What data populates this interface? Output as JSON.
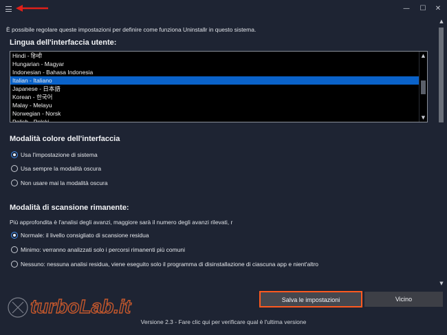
{
  "titlebar": {
    "minimize": "—",
    "maximize": "☐",
    "close": "✕"
  },
  "intro_text": "È possibile regolare queste impostazioni per definire come funziona Uninstallr in questo sistema.",
  "language": {
    "title": "Lingua dell'interfaccia utente:",
    "items": [
      "Hindi - हिन्दी",
      "Hungarian - Magyar",
      "Indonesian - Bahasa Indonesia",
      "Italian - Italiano",
      "Japanese - 日本語",
      "Korean - 한국어",
      "Malay - Melayu",
      "Norwegian - Norsk",
      "Polish - Polski"
    ],
    "selected_index": 3
  },
  "color_mode": {
    "title": "Modalità colore dell'interfaccia",
    "options": [
      "Usa l'impostazione di sistema",
      "Usa sempre la modalità oscura",
      "Non usare mai la modalità oscura"
    ],
    "selected_index": 0
  },
  "scan_mode": {
    "title": "Modalità di scansione rimanente:",
    "description": "Più approfondita è l'analisi degli avanzi, maggiore sarà il numero degli avanzi rilevati, r",
    "options": [
      "Normale: il livello consigliato di scansione residua",
      "Minimo: verranno analizzati solo i percorsi rimanenti più comuni",
      "Nessuno: nessuna analisi residua, viene eseguito solo il programma di disinstallazione di ciascuna app e nient'altro"
    ],
    "selected_index": 0
  },
  "buttons": {
    "save": "Salva le impostazioni",
    "close": "Vicino"
  },
  "version_text": "Versione 2.3 - Fare clic qui per verificare qual è l'ultima versione",
  "watermark": {
    "brand": "turbolab.it"
  },
  "colors": {
    "background": "#1e2433",
    "selection": "#0a62c9",
    "accent_radio": "#3f8ef2",
    "annotation_red": "#e0201a",
    "highlight_orange": "#ff5a1f"
  }
}
